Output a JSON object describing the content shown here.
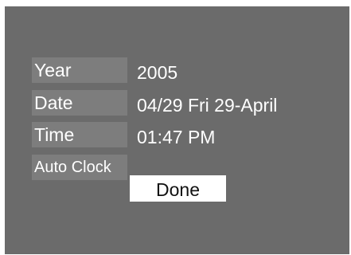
{
  "settings": {
    "year": {
      "label": "Year",
      "value": "2005"
    },
    "date": {
      "label": "Date",
      "value": "04/29 Fri 29-April"
    },
    "time": {
      "label": "Time",
      "value": "01:47 PM"
    },
    "auto_clock": {
      "label": "Auto Clock"
    }
  },
  "done_label": "Done"
}
